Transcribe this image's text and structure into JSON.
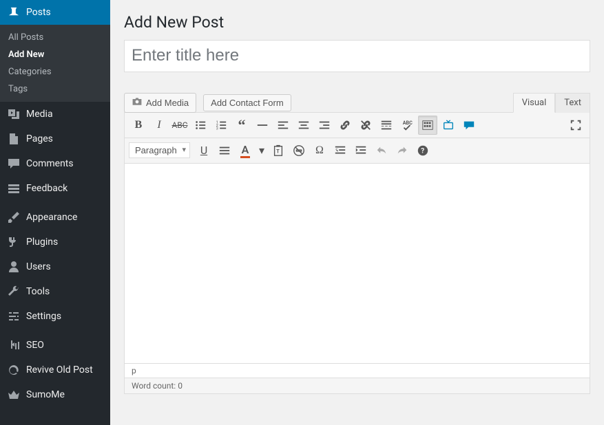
{
  "sidebar": {
    "posts": {
      "label": "Posts"
    },
    "submenu": [
      {
        "label": "All Posts"
      },
      {
        "label": "Add New"
      },
      {
        "label": "Categories"
      },
      {
        "label": "Tags"
      }
    ],
    "media": {
      "label": "Media"
    },
    "pages": {
      "label": "Pages"
    },
    "comments": {
      "label": "Comments"
    },
    "feedback": {
      "label": "Feedback"
    },
    "appearance": {
      "label": "Appearance"
    },
    "plugins": {
      "label": "Plugins"
    },
    "users": {
      "label": "Users"
    },
    "tools": {
      "label": "Tools"
    },
    "settings": {
      "label": "Settings"
    },
    "seo": {
      "label": "SEO"
    },
    "revive": {
      "label": "Revive Old Post"
    },
    "sumome": {
      "label": "SumoMe"
    }
  },
  "page": {
    "title": "Add New Post",
    "title_placeholder": "Enter title here"
  },
  "buttons": {
    "add_media": "Add Media",
    "add_contact_form": "Add Contact Form"
  },
  "tabs": {
    "visual": "Visual",
    "text": "Text"
  },
  "format_select": "Paragraph",
  "status": {
    "path": "p",
    "word_count_label": "Word count: ",
    "word_count": "0"
  }
}
